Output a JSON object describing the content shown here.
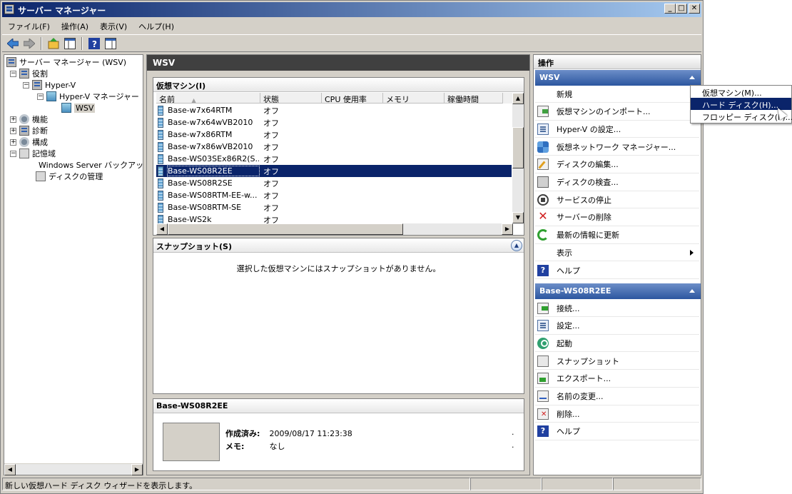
{
  "window": {
    "title": "サーバー マネージャー",
    "buttons": {
      "minimize": "_",
      "maximize": "□",
      "close": "✕"
    }
  },
  "menubar": [
    "ファイル(F)",
    "操作(A)",
    "表示(V)",
    "ヘルプ(H)"
  ],
  "toolbar": [
    "back-icon",
    "forward-icon",
    "up-icon",
    "show-hide-tree-icon",
    "help-icon",
    "action-pane-icon"
  ],
  "tree": {
    "root": "サーバー マネージャー (WSV)",
    "roles": "役割",
    "hyperv": "Hyper-V",
    "hyperv_manager": "Hyper-V マネージャー",
    "wsv": "WSV",
    "features": "機能",
    "diagnostics": "診断",
    "configuration": "構成",
    "storage": "記憶域",
    "backup": "Windows Server バックアップ",
    "disk_mgmt": "ディスクの管理"
  },
  "center": {
    "header": "WSV",
    "vm_group_title": "仮想マシン(I)",
    "columns": [
      "名前",
      "状態",
      "CPU 使用率",
      "メモリ",
      "稼働時間"
    ],
    "vms": [
      {
        "name": "Base-w7x64RTM",
        "state": "オフ"
      },
      {
        "name": "Base-w7x64wVB2010",
        "state": "オフ"
      },
      {
        "name": "Base-w7x86RTM",
        "state": "オフ"
      },
      {
        "name": "Base-w7x86wVB2010",
        "state": "オフ"
      },
      {
        "name": "Base-WS03SEx86R2(S...",
        "state": "オフ"
      },
      {
        "name": "Base-WS08R2EE",
        "state": "オフ"
      },
      {
        "name": "Base-WS08R2SE",
        "state": "オフ"
      },
      {
        "name": "Base-WS08RTM-EE-w...",
        "state": "オフ"
      },
      {
        "name": "Base-WS08RTM-SE",
        "state": "オフ"
      },
      {
        "name": "Base-WS2k",
        "state": "オフ"
      }
    ],
    "selected_index": 5,
    "snapshot_title": "スナップショット(S)",
    "snapshot_empty": "選択した仮想マシンにはスナップショットがありません。",
    "detail_title": "Base-WS08R2EE",
    "created_label": "作成済み:",
    "created_value": "2009/08/17 11:23:38",
    "memo_label": "メモ:",
    "memo_value": "なし",
    "dot": "."
  },
  "actions": {
    "title": "操作",
    "section1": "WSV",
    "items1": [
      {
        "label": "新規",
        "icon": "blank-icon",
        "submenu": false
      },
      {
        "label": "仮想マシンのインポート...",
        "icon": "import-icon"
      },
      {
        "label": "Hyper-V の設定...",
        "icon": "settings-icon"
      },
      {
        "label": "仮想ネットワーク マネージャー...",
        "icon": "network-icon"
      },
      {
        "label": "ディスクの編集...",
        "icon": "edit-disk-icon"
      },
      {
        "label": "ディスクの検査...",
        "icon": "inspect-disk-icon"
      },
      {
        "label": "サービスの停止",
        "icon": "stop-icon"
      },
      {
        "label": "サーバーの削除",
        "icon": "delete-icon"
      },
      {
        "label": "最新の情報に更新",
        "icon": "refresh-icon"
      },
      {
        "label": "表示",
        "icon": "blank-icon",
        "submenu": true
      },
      {
        "label": "ヘルプ",
        "icon": "help-icon"
      }
    ],
    "section2": "Base-WS08R2EE",
    "items2": [
      {
        "label": "接続...",
        "icon": "connect-icon"
      },
      {
        "label": "設定...",
        "icon": "settings-icon"
      },
      {
        "label": "起動",
        "icon": "power-icon"
      },
      {
        "label": "スナップショット",
        "icon": "snapshot-icon"
      },
      {
        "label": "エクスポート...",
        "icon": "export-icon"
      },
      {
        "label": "名前の変更...",
        "icon": "rename-icon"
      },
      {
        "label": "削除...",
        "icon": "delete-vm-icon"
      },
      {
        "label": "ヘルプ",
        "icon": "help-icon"
      }
    ]
  },
  "submenu": [
    "仮想マシン(M)...",
    "ハード ディスク(H)...",
    "フロッピー ディスク(F)..."
  ],
  "submenu_highlight": 1,
  "statusbar": "新しい仮想ハード ディスク ウィザードを表示します。",
  "colors": {
    "selection": "#0a246a",
    "section_header": "#2c56a0",
    "title_bar": "#0a246a"
  }
}
